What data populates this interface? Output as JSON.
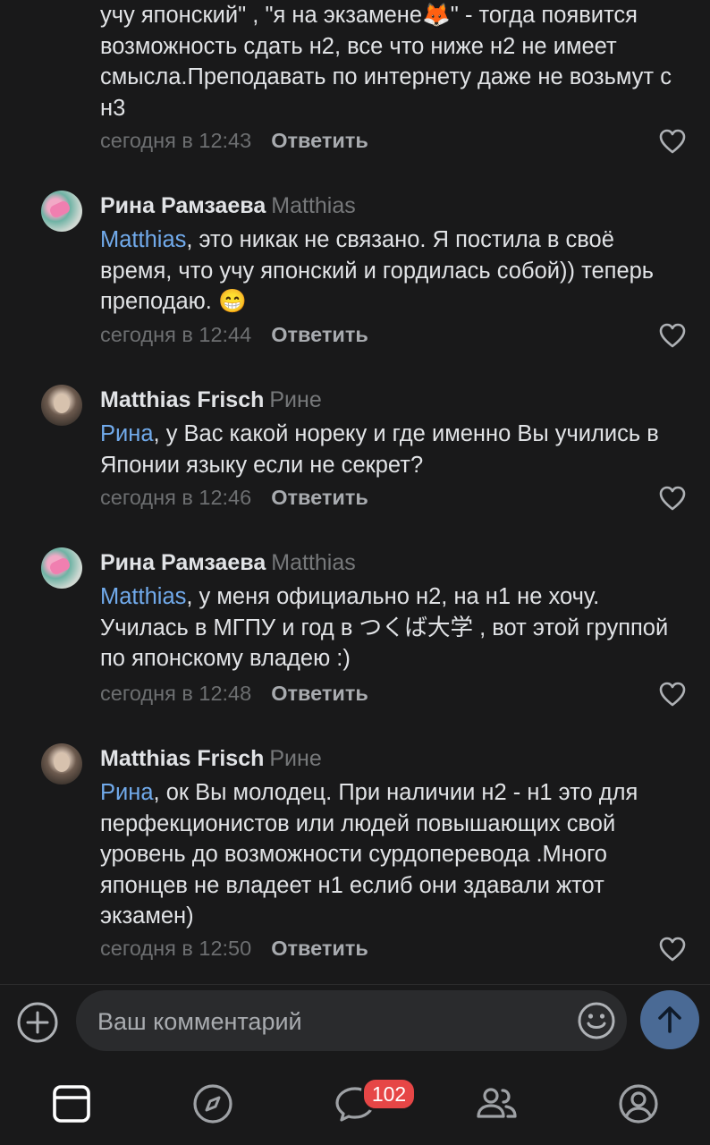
{
  "comments": [
    {
      "text": "учу японский\" , \"я на экзамене🦊\" - тогда появится возможность сдать н2, все что ниже н2 не имеет смысла.Преподавать по интернету даже не возьмут с н3",
      "time": "сегодня в 12:43",
      "reply_label": "Ответить"
    },
    {
      "author": "Рина Рамзаева",
      "reply_to": "Matthias",
      "mention": "Matthias",
      "text": ", это никак не связано. Я постила в своё время, что учу японский и гордилась собой)) теперь преподаю. 😁",
      "time": "сегодня в 12:44",
      "reply_label": "Ответить"
    },
    {
      "author": "Matthias Frisch",
      "reply_to": "Рине",
      "mention": "Рина",
      "text": ", у Вас какой нореку и где именно Вы учились в Японии языку если не секрет?",
      "time": "сегодня в 12:46",
      "reply_label": "Ответить"
    },
    {
      "author": "Рина Рамзаева",
      "reply_to": "Matthias",
      "mention": "Matthias",
      "text": ", у меня официально н2, на н1 не хочу. Училась в МГПУ и год в つくば大学 , вот этой группой по японскому владею :)",
      "time": "сегодня в 12:48",
      "reply_label": "Ответить"
    },
    {
      "author": "Matthias Frisch",
      "reply_to": "Рине",
      "mention": "Рина",
      "text": ", ок Вы молодец. При наличии н2 - н1 это для перфекционистов или людей повышающих свой уровень до возможности сурдоперевода .Много японцев не владеет н1 еслиб они здавали жтот экзамен)",
      "time": "сегодня в 12:50",
      "reply_label": "Ответить"
    }
  ],
  "composer": {
    "placeholder": "Ваш комментарий",
    "attach_icon": "plus-circle-icon",
    "emoji_icon": "smile-icon",
    "send_icon": "arrow-up-icon"
  },
  "tabbar": {
    "items": [
      "feed-icon",
      "compass-icon",
      "messages-icon",
      "friends-icon",
      "profile-icon"
    ],
    "messages_badge": "102"
  },
  "colors": {
    "background": "#19191a",
    "text": "#e1e3e6",
    "mention": "#71aaeb",
    "muted": "#76787a",
    "send_button": "#4a6a95",
    "badge": "#e64646"
  }
}
